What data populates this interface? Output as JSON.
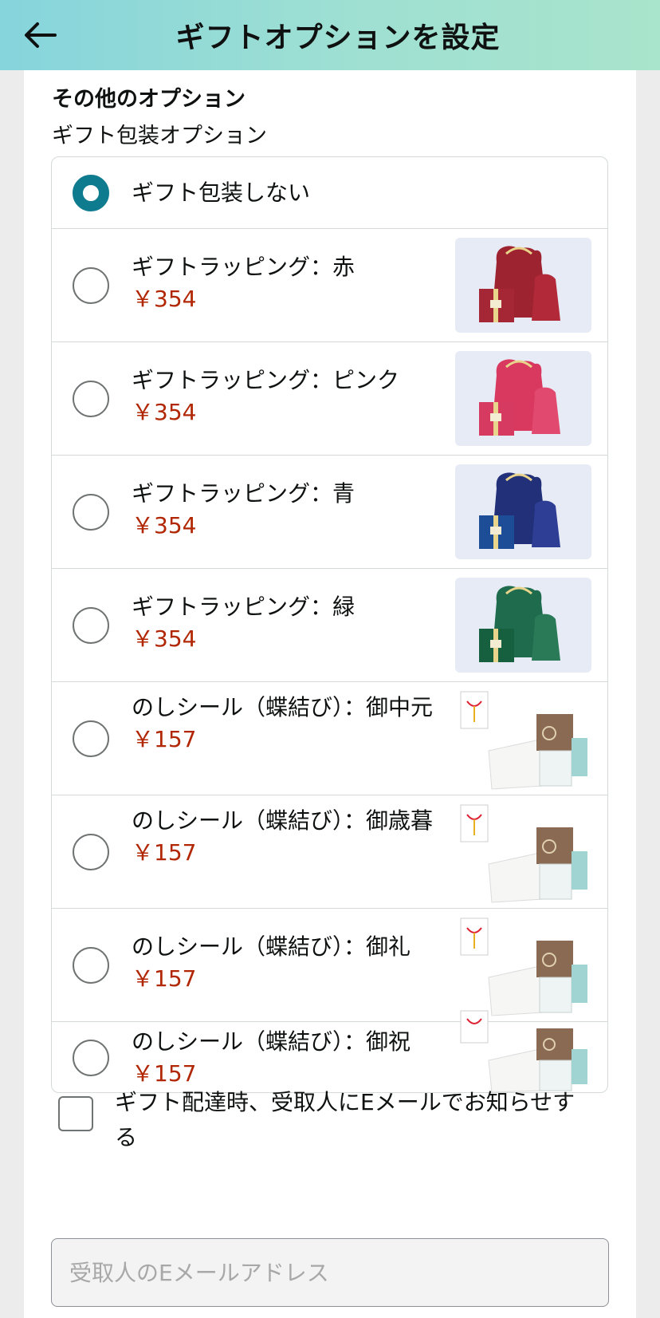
{
  "header": {
    "title": "ギフトオプションを設定",
    "back_icon": "arrow-left-icon",
    "gradient_colors": [
      "#86d4dc",
      "#a9e4cc"
    ]
  },
  "section": {
    "title": "その他のオプション",
    "subtitle": "ギフト包装オプション"
  },
  "options": [
    {
      "label": "ギフト包装しない",
      "price": "",
      "selected": true
    },
    {
      "label": "ギフトラッピング：赤",
      "price": "￥354",
      "selected": false,
      "color": "#9e2330"
    },
    {
      "label": "ギフトラッピング：ピンク",
      "price": "￥354",
      "selected": false,
      "color": "#d9395f"
    },
    {
      "label": "ギフトラッピング：青",
      "price": "￥354",
      "selected": false,
      "color": "#1f3a8a"
    },
    {
      "label": "ギフトラッピング：緑",
      "price": "￥354",
      "selected": false,
      "color": "#1e6b4d"
    },
    {
      "label": "のしシール（蝶結び）：御中元",
      "price": "￥157",
      "selected": false
    },
    {
      "label": "のしシール（蝶結び）：御歳暮",
      "price": "￥157",
      "selected": false
    },
    {
      "label": "のしシール（蝶結び）：御礼",
      "price": "￥157",
      "selected": false
    },
    {
      "label": "のしシール（蝶結び）：御祝",
      "price": "￥157",
      "selected": false
    }
  ],
  "notify": {
    "label": "ギフト配達時、受取人にEメールでお知らせする",
    "checked": false
  },
  "email": {
    "placeholder": "受取人のEメールアドレス",
    "value": ""
  },
  "colors": {
    "accent": "#0f7b8f",
    "price": "#b12704"
  }
}
